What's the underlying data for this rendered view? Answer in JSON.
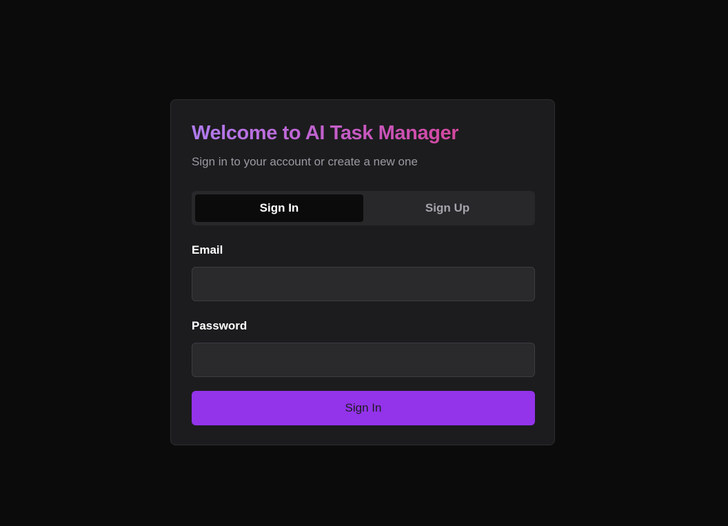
{
  "auth_card": {
    "title": "Welcome to AI Task Manager",
    "subtitle": "Sign in to your account or create a new one",
    "tabs": [
      {
        "label": "Sign In",
        "active": true
      },
      {
        "label": "Sign Up",
        "active": false
      }
    ],
    "email": {
      "label": "Email",
      "value": "",
      "placeholder": ""
    },
    "password": {
      "label": "Password",
      "value": "",
      "placeholder": ""
    },
    "submit_label": "Sign In"
  },
  "colors": {
    "page_background": "#0b0b0c",
    "card_background": "#1c1c1e",
    "title_gradient_start": "#b07cf0",
    "title_gradient_end": "#d4479f",
    "primary_button": "#9333ea",
    "active_tab": "#0b0b0c",
    "input_background": "#2a2a2d"
  }
}
